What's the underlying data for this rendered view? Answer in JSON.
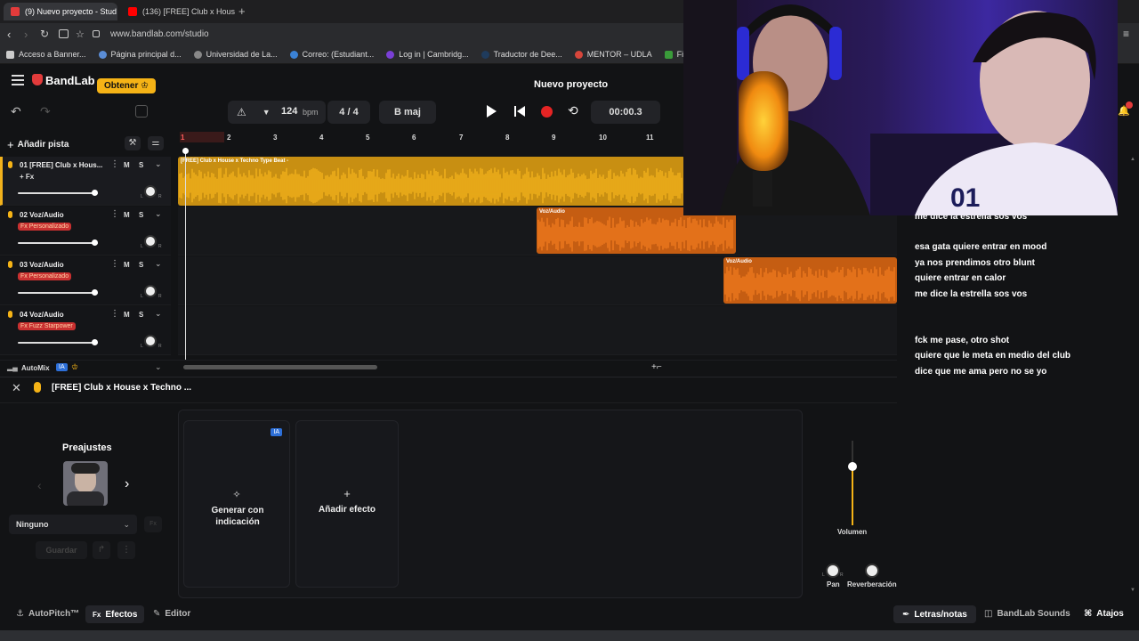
{
  "browser": {
    "tabs": [
      {
        "label": "(9) Nuevo proyecto - Stud",
        "active": true
      },
      {
        "label": "(136) [FREE] Club x House",
        "active": false
      }
    ],
    "new_tab": "+",
    "url": "www.bandlab.com/studio",
    "bookmarks": [
      "Acceso a Banner...",
      "Página principal d...",
      "Universidad de La...",
      "Correo: (Estudiant...",
      "Log in | Cambridg...",
      "Traductor de Dee...",
      "MENTOR – UDLA",
      "Fi"
    ]
  },
  "app": {
    "brand": "BandLab",
    "obtener": "Obtener",
    "project_title": "Nuevo proyecto",
    "bpm_value": "124",
    "bpm_unit": "bpm",
    "time_sig": "4 / 4",
    "key": "B maj",
    "time": "00:00.3",
    "add_track": "Añadir pista"
  },
  "ruler": [
    "1",
    "2",
    "3",
    "4",
    "5",
    "6",
    "7",
    "8",
    "9",
    "10",
    "11"
  ],
  "tracks": [
    {
      "num": "01",
      "name": "[FREE] Club x Hous...",
      "fx": "+ Fx",
      "fx_style": "plain",
      "volume": 0.97
    },
    {
      "num": "02",
      "name": "Voz/Audio",
      "fx": "Fx Personalizado",
      "fx_style": "badge",
      "volume": 0.97
    },
    {
      "num": "03",
      "name": "Voz/Audio",
      "fx": "Fx Personalizado",
      "fx_style": "badge",
      "volume": 0.97
    },
    {
      "num": "04",
      "name": "Voz/Audio",
      "fx": "Fx Fuzz Starpower",
      "fx_style": "badge",
      "volume": 0.97
    }
  ],
  "track_buttons": {
    "mute": "M",
    "solo": "S",
    "pan_l": "L",
    "pan_r": "R"
  },
  "clips": [
    {
      "label": "[FREE] Club x House x Techno Type Beat -",
      "color": "#f2b21c"
    },
    {
      "label": "Voz/Audio",
      "color": "#f07a1e"
    },
    {
      "label": "Voz/Audio",
      "color": "#f07a1e"
    }
  ],
  "automix": {
    "label": "AutoMix",
    "badge": "IA"
  },
  "panel": {
    "track_title": "[FREE] Club x House x Techno ...",
    "presets_title": "Preajustes",
    "preset_select": "Ninguno",
    "save": "Guardar",
    "ai_badge": "IA",
    "generate": "Generar con indicación",
    "add_effect": "Añadir efecto",
    "volume": "Volumen",
    "pan": "Pan",
    "reverb": "Reverberación",
    "volume_level": 0.7,
    "pan_l": "L",
    "pan_r": "R"
  },
  "lyrics": [
    "me dice la estrella sos vos",
    "esa gata quiere entrar en mood",
    "ya nos prendimos otro blunt",
    "quiere entrar en calor",
    "me dice la estrella sos vos",
    "fck me pase, otro shot",
    "quiere que le meta en medio del club",
    "dice que me ama pero no se yo"
  ],
  "footer": {
    "autopitch": "AutoPitch™",
    "effects": "Efectos",
    "editor": "Editor",
    "lyrics_notes": "Letras/notas",
    "sounds": "BandLab Sounds",
    "shortcuts": "Atajos"
  }
}
